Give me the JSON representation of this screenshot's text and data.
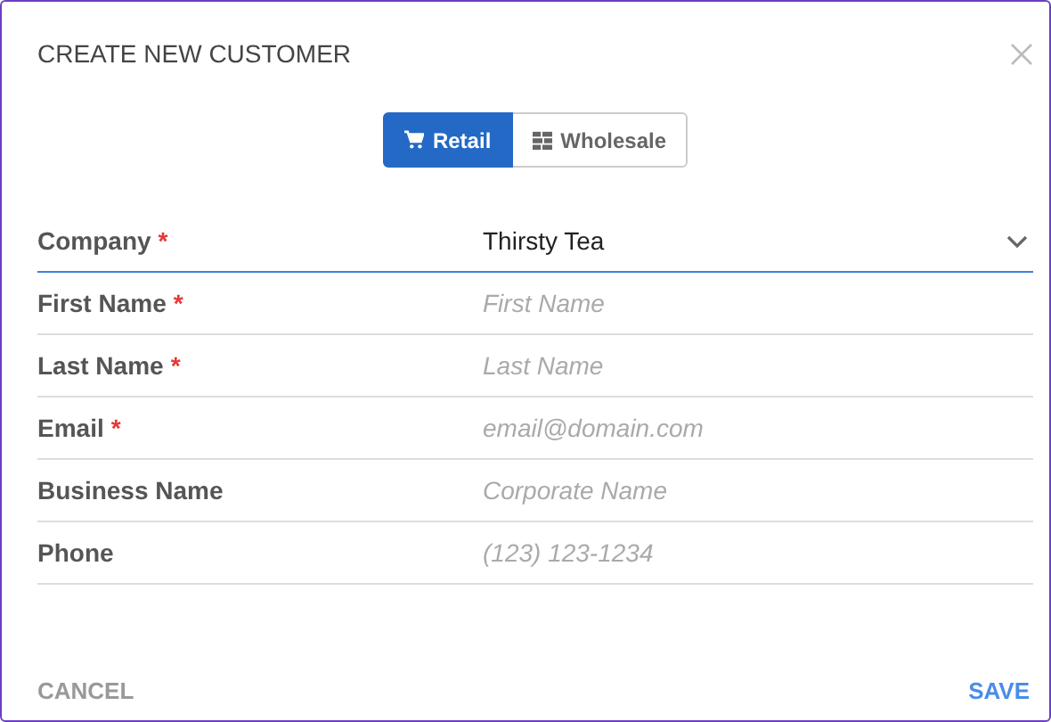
{
  "dialog": {
    "title": "CREATE NEW CUSTOMER"
  },
  "customer_types": [
    {
      "label": "Retail",
      "kind": "cart",
      "selected": true
    },
    {
      "label": "Wholesale",
      "kind": "stack",
      "selected": false
    }
  ],
  "fields": [
    {
      "label": "Company",
      "required_mark": "*",
      "kind": "select",
      "value": "Thirsty Tea",
      "focused": true
    },
    {
      "label": "First Name",
      "required_mark": "*",
      "kind": "text",
      "placeholder": "First Name",
      "focused": false
    },
    {
      "label": "Last Name",
      "required_mark": "*",
      "kind": "text",
      "placeholder": "Last Name",
      "focused": false
    },
    {
      "label": "Email",
      "required_mark": "*",
      "kind": "text",
      "placeholder": "email@domain.com",
      "focused": false
    },
    {
      "label": "Business Name",
      "kind": "text",
      "placeholder": "Corporate Name",
      "focused": false
    },
    {
      "label": "Phone",
      "kind": "text",
      "placeholder": "(123) 123-1234",
      "focused": false
    }
  ],
  "actions": {
    "cancel": "CANCEL",
    "save": "SAVE"
  }
}
